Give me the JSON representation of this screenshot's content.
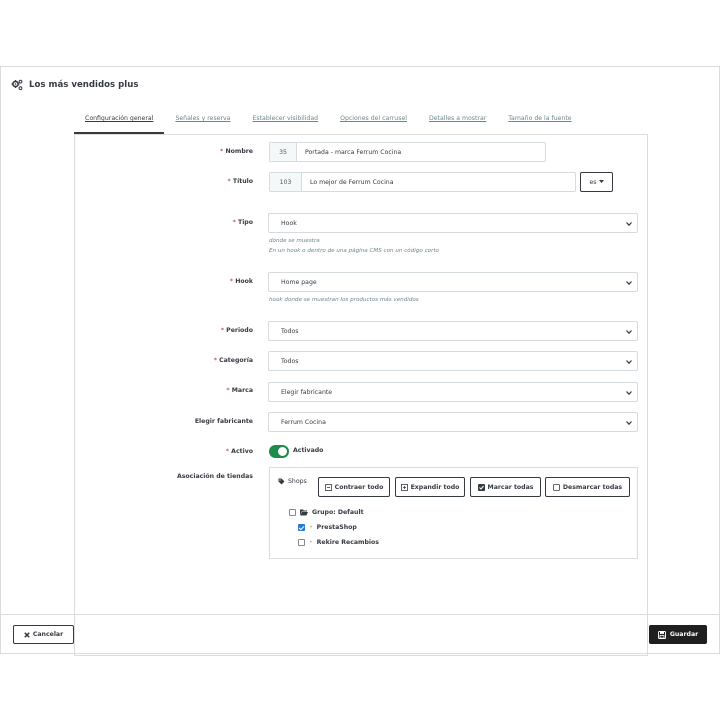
{
  "panel": {
    "title": "Los más vendidos plus",
    "icon": "cogs-icon"
  },
  "tabs": [
    {
      "label": "Configuración general",
      "active": true
    },
    {
      "label": "Señales y reserva",
      "active": false
    },
    {
      "label": "Establecer visibilidad",
      "active": false
    },
    {
      "label": "Opciones del carrusel",
      "active": false
    },
    {
      "label": "Detalles a mostrar",
      "active": false
    },
    {
      "label": "Tamaño de la fuente",
      "active": false
    }
  ],
  "form": {
    "required_mark": "*",
    "nombre": {
      "label": "Nombre",
      "prefix": "35",
      "value": "Portada - marca Ferrum Cocina"
    },
    "titulo": {
      "label": "Título",
      "prefix": "103",
      "value": "Lo mejor de Ferrum Cocina",
      "lang": "es"
    },
    "tipo": {
      "label": "Tipo",
      "value": "Hook",
      "help": [
        "dónde se muestra",
        "En un hook o dentro de una página CMS con un código corto"
      ]
    },
    "hook": {
      "label": "Hook",
      "value": "Home page",
      "help": "hook donde se muestran los productos más vendidos"
    },
    "periodo": {
      "label": "Periodo",
      "value": "Todos"
    },
    "categoria": {
      "label": "Categoría",
      "value": "Todos"
    },
    "marca": {
      "label": "Marca",
      "value": "Elegir fabricante"
    },
    "elegir_fabricante": {
      "label": "Elegir fabricante",
      "value": "Ferrum Cocina"
    },
    "activo": {
      "label": "Activo",
      "state_label": "Activado",
      "on": true
    },
    "asociacion": {
      "label": "Asociación de tiendas",
      "tree_title": "Shops",
      "buttons": {
        "collapse": "Contraer todo",
        "expand": "Expandir todo",
        "check_all": "Marcar todas",
        "uncheck_all": "Desmarcar todas"
      },
      "group": {
        "label": "Grupo: Default",
        "checked": false
      },
      "shops": [
        {
          "label": "PrestaShop",
          "checked": true
        },
        {
          "label": "Rekire Recambios",
          "checked": false
        }
      ]
    }
  },
  "footer": {
    "cancel_label": "Cancelar",
    "save_label": "Guardar"
  },
  "colors": {
    "switch_on": "#1e8a4c",
    "save_bg": "#1f1f1f",
    "checkbox_checked": "#2a7ad5",
    "required": "#c05c67"
  }
}
